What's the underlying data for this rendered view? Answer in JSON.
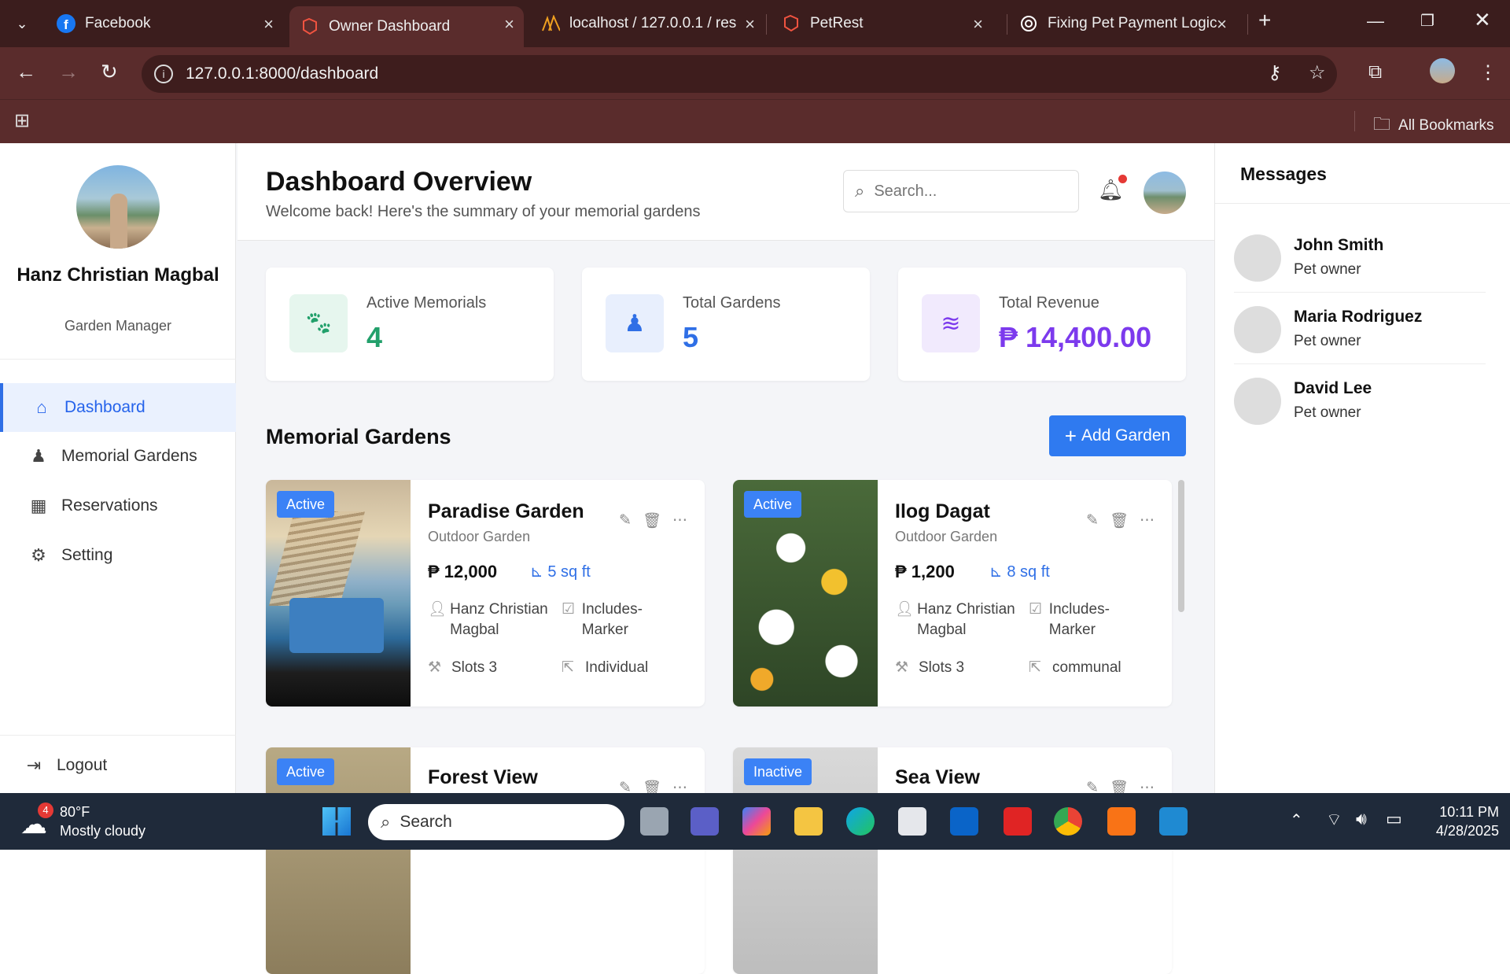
{
  "browser": {
    "tabs": [
      {
        "title": "Facebook",
        "icon": "facebook-icon"
      },
      {
        "title": "Owner Dashboard",
        "icon": "laravel-icon",
        "active": true
      },
      {
        "title": "localhost / 127.0.0.1 / res",
        "icon": "phpmyadmin-icon"
      },
      {
        "title": "PetRest",
        "icon": "laravel-icon"
      },
      {
        "title": "Fixing Pet Payment Logic",
        "icon": "openai-icon"
      }
    ],
    "url": "127.0.0.1:8000/dashboard",
    "bookmarks_label": "All Bookmarks",
    "theme_color": "#5a2c2c"
  },
  "sidebar": {
    "user_name": "Hanz Christian Magbal",
    "user_role": "Garden Manager",
    "nav": [
      {
        "label": "Dashboard",
        "icon": "home-icon",
        "active": true
      },
      {
        "label": "Memorial Gardens",
        "icon": "monument-icon"
      },
      {
        "label": "Reservations",
        "icon": "calendar-icon"
      },
      {
        "label": "Setting",
        "icon": "gear-icon"
      }
    ],
    "logout_label": "Logout"
  },
  "header": {
    "title": "Dashboard Overview",
    "subtitle": "Welcome back! Here's the summary of your memorial gardens",
    "search_placeholder": "Search..."
  },
  "stats": [
    {
      "label": "Active Memorials",
      "value": "4",
      "icon": "paw-icon",
      "color": "#22a06b",
      "bg": "#e6f6ee"
    },
    {
      "label": "Total Gardens",
      "value": "5",
      "icon": "monument-icon",
      "color": "#2f6fe6",
      "bg": "#e8effd"
    },
    {
      "label": "Total Revenue",
      "value": "₱ 14,400.00",
      "icon": "coins-icon",
      "color": "#7c3aed",
      "bg": "#f1eafd"
    }
  ],
  "gardens_section": {
    "title": "Memorial Gardens",
    "add_label": "Add Garden"
  },
  "gardens": [
    {
      "status": "Active",
      "name": "Paradise Garden",
      "type": "Outdoor Garden",
      "price": "₱ 12,000",
      "size": "5 sq ft",
      "owner": "Hanz Christian Magbal",
      "marker": "Includes-Marker",
      "slots": "Slots 3",
      "kind": "Individual"
    },
    {
      "status": "Active",
      "name": "Ilog Dagat",
      "type": "Outdoor Garden",
      "price": "₱ 1,200",
      "size": "8 sq ft",
      "owner": "Hanz Christian Magbal",
      "marker": "Includes-Marker",
      "slots": "Slots 3",
      "kind": "communal"
    },
    {
      "status": "Active",
      "name": "Forest View"
    },
    {
      "status": "Inactive",
      "name": "Sea View"
    }
  ],
  "messages": {
    "title": "Messages",
    "items": [
      {
        "name": "John Smith",
        "role": "Pet owner"
      },
      {
        "name": "Maria Rodriguez",
        "role": "Pet owner"
      },
      {
        "name": "David Lee",
        "role": "Pet owner"
      }
    ]
  },
  "taskbar": {
    "weather_temp": "80°F",
    "weather_desc": "Mostly cloudy",
    "weather_badge": "4",
    "search_label": "Search",
    "time": "10:11 PM",
    "date": "4/28/2025"
  }
}
